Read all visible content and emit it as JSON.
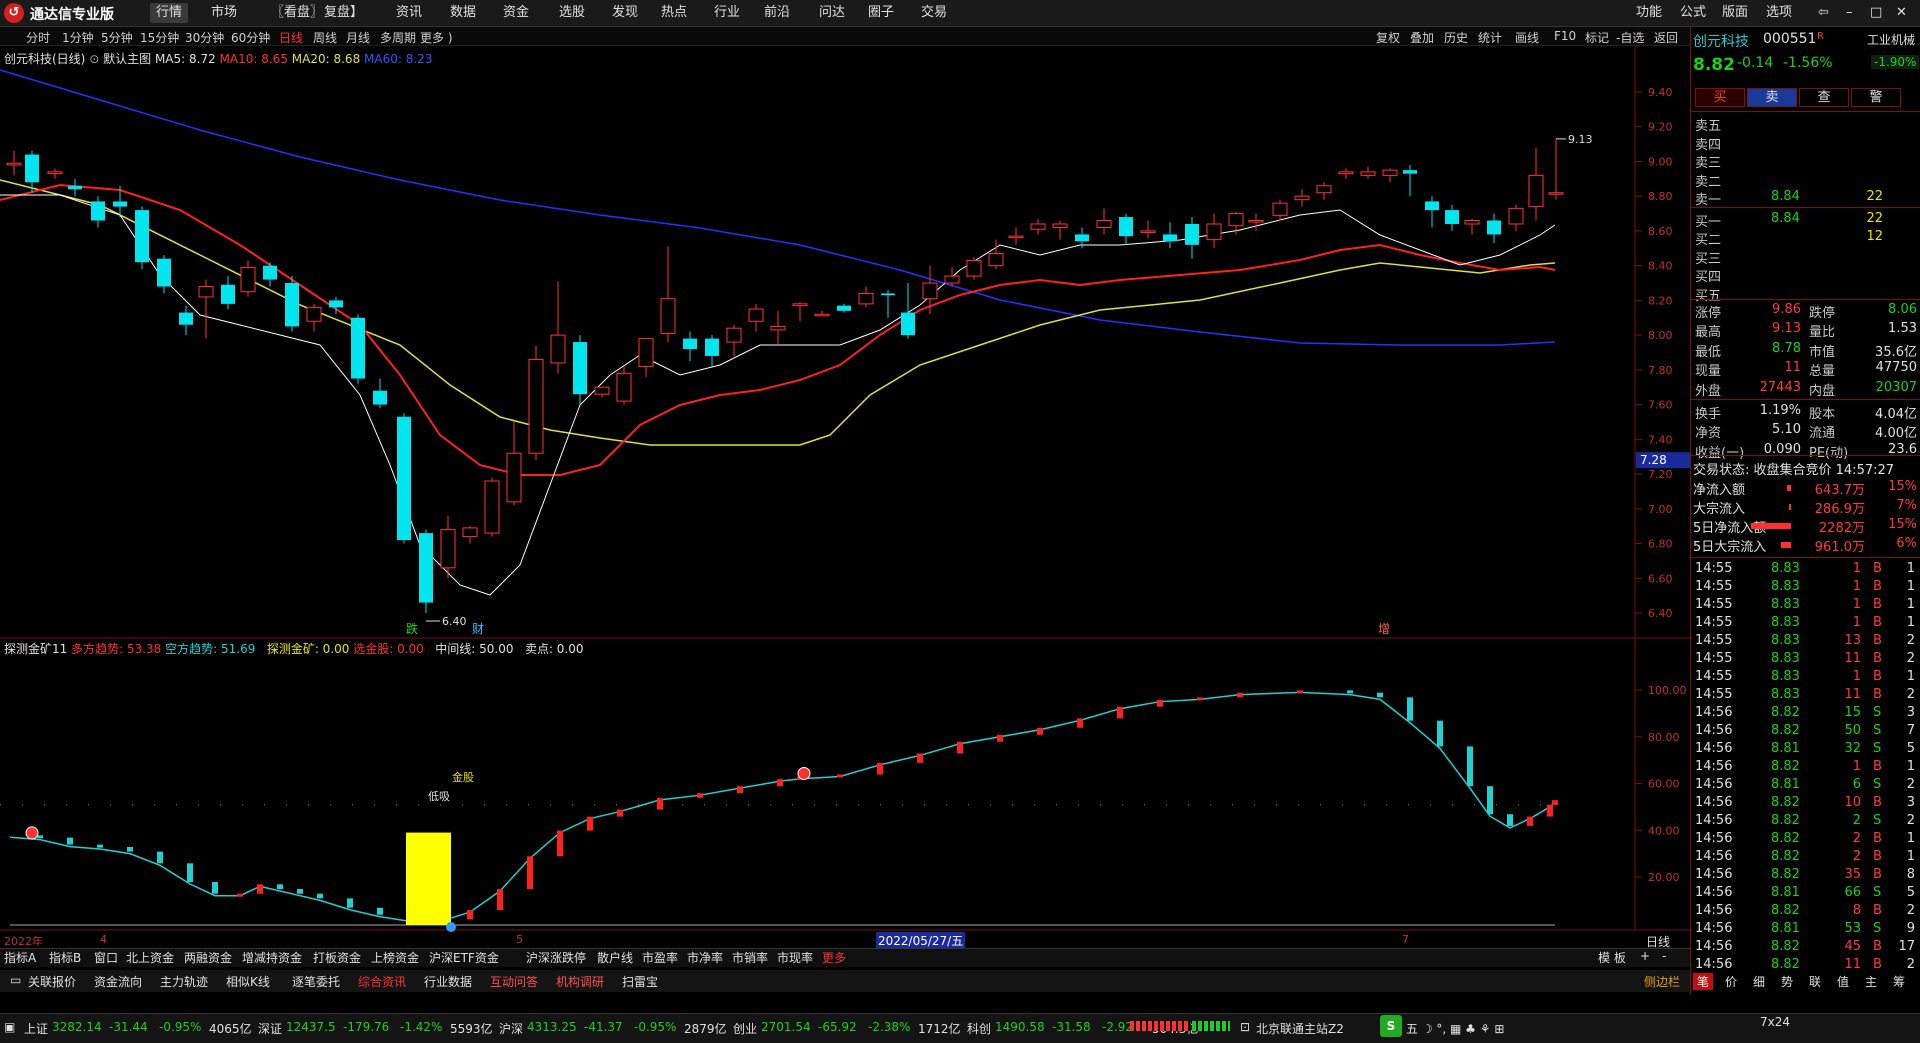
{
  "app": {
    "title": "通达信专业版"
  },
  "menu": [
    "行情",
    "市场",
    "〖看盘〗",
    "复盘】",
    "资讯",
    "数据",
    "资金",
    "选股",
    "发现",
    "热点",
    "行业",
    "前沿",
    "问达",
    "圈子",
    "交易"
  ],
  "menu_right": [
    "功能",
    "公式",
    "版面",
    "选项"
  ],
  "periods": [
    "分时",
    "1分钟",
    "5分钟",
    "15分钟",
    "30分钟",
    "60分钟",
    "日线",
    "周线",
    "月线",
    "多周期",
    "更多 )"
  ],
  "active_period": "日线",
  "tools": [
    "复权",
    "叠加",
    "历史",
    "统计",
    "画线",
    "F10",
    "标记",
    "-自选",
    "返回"
  ],
  "chart": {
    "stock_label": "创元科技(日线)",
    "template": "默认主图",
    "ma5": "MA5: 8.72",
    "ma10": "MA10: 8.65",
    "ma20": "MA20: 8.68",
    "ma60": "MA60: 8.23",
    "price_ticks": [
      "9.40",
      "9.20",
      "9.00",
      "8.80",
      "8.60",
      "8.40",
      "8.20",
      "8.00",
      "7.80",
      "7.60",
      "7.40",
      "7.20",
      "7.00",
      "6.80",
      "6.60",
      "6.40"
    ],
    "current_price_tag": "7.28",
    "high_mark": "9.13",
    "low_mark": "6.40",
    "event_labels": [
      "跌",
      "财",
      "增"
    ],
    "colors": {
      "up": "#ff3333",
      "down": "#00e5ee",
      "ma5": "#ffffff",
      "ma10": "#ff2020",
      "ma20": "#e0e040",
      "ma60": "#2233ff"
    }
  },
  "indicator": {
    "name": "探测金矿11",
    "bull": "多方趋势: 53.38",
    "bear": "空方趋势: 51.69",
    "probe": "探测金矿: 0.00",
    "pick": "选金股: 0.00",
    "mid": "中间线: 50.00",
    "sell": "卖点: 0.00",
    "ticks": [
      "100.00",
      "80.00",
      "60.00",
      "40.00",
      "20.00"
    ],
    "gold_label": "金股",
    "low_buy_label": "低吸"
  },
  "date_axis": {
    "year": "2022年",
    "m1": "4",
    "m2": "5",
    "date_tag": "2022/05/27/五",
    "m3": "7",
    "period": "日线"
  },
  "stock": {
    "name": "创元科技",
    "code": "000551",
    "flag": "R",
    "price": "8.82",
    "change": "-0.14",
    "pct": "-1.56%",
    "industry": "工业机械",
    "industry_pct": "-1.90%",
    "buttons": [
      "买",
      "卖",
      "查",
      "警"
    ]
  },
  "orderbook": {
    "sells": [
      {
        "l": "卖五",
        "p": "",
        "v": ""
      },
      {
        "l": "卖四",
        "p": "",
        "v": ""
      },
      {
        "l": "卖三",
        "p": "",
        "v": ""
      },
      {
        "l": "卖二",
        "p": "",
        "v": ""
      },
      {
        "l": "卖一",
        "p": "8.84",
        "v": "22"
      }
    ],
    "buys": [
      {
        "l": "买一",
        "p": "8.84",
        "v": "22"
      },
      {
        "l": "买二",
        "p": "",
        "v": "12"
      },
      {
        "l": "买三",
        "p": "",
        "v": ""
      },
      {
        "l": "买四",
        "p": "",
        "v": ""
      },
      {
        "l": "买五",
        "p": "",
        "v": ""
      }
    ]
  },
  "stats": [
    [
      "涨停",
      "9.86",
      "跌停",
      "8.06"
    ],
    [
      "最高",
      "9.13",
      "量比",
      "1.53"
    ],
    [
      "最低",
      "8.78",
      "市值",
      "35.6亿"
    ],
    [
      "现量",
      "11",
      "总量",
      "47750"
    ],
    [
      "外盘",
      "27443",
      "内盘",
      "20307"
    ],
    [
      "换手",
      "1.19%",
      "股本",
      "4.04亿"
    ],
    [
      "净资",
      "5.10",
      "流通",
      "4.00亿"
    ],
    [
      "收益(一)",
      "0.090",
      "PE(动)",
      "23.6"
    ]
  ],
  "trade_status": "交易状态: 收盘集合竞价 14:57:27",
  "flows": [
    {
      "l": "净流入额",
      "v": "643.7万",
      "p": "15%"
    },
    {
      "l": "大宗流入",
      "v": "286.9万",
      "p": "7%"
    },
    {
      "l": "5日净流入额",
      "v": "2282万",
      "p": "15%"
    },
    {
      "l": "5日大宗流入",
      "v": "961.0万",
      "p": "6%"
    }
  ],
  "ticks": [
    [
      "14:55",
      "8.83",
      "1",
      "B",
      "1"
    ],
    [
      "14:55",
      "8.83",
      "1",
      "B",
      "1"
    ],
    [
      "14:55",
      "8.83",
      "1",
      "B",
      "1"
    ],
    [
      "14:55",
      "8.83",
      "1",
      "B",
      "1"
    ],
    [
      "14:55",
      "8.83",
      "13",
      "B",
      "2"
    ],
    [
      "14:55",
      "8.83",
      "11",
      "B",
      "2"
    ],
    [
      "14:55",
      "8.83",
      "1",
      "B",
      "1"
    ],
    [
      "14:55",
      "8.83",
      "11",
      "B",
      "2"
    ],
    [
      "14:56",
      "8.82",
      "15",
      "S",
      "3"
    ],
    [
      "14:56",
      "8.82",
      "50",
      "S",
      "7"
    ],
    [
      "14:56",
      "8.81",
      "32",
      "S",
      "5"
    ],
    [
      "14:56",
      "8.82",
      "1",
      "B",
      "1"
    ],
    [
      "14:56",
      "8.81",
      "6",
      "S",
      "2"
    ],
    [
      "14:56",
      "8.82",
      "10",
      "B",
      "3"
    ],
    [
      "14:56",
      "8.82",
      "2",
      "S",
      "2"
    ],
    [
      "14:56",
      "8.82",
      "2",
      "B",
      "1"
    ],
    [
      "14:56",
      "8.82",
      "2",
      "B",
      "1"
    ],
    [
      "14:56",
      "8.82",
      "35",
      "B",
      "8"
    ],
    [
      "14:56",
      "8.81",
      "66",
      "S",
      "5"
    ],
    [
      "14:56",
      "8.82",
      "8",
      "B",
      "2"
    ],
    [
      "14:56",
      "8.81",
      "53",
      "S",
      "9"
    ],
    [
      "14:56",
      "8.82",
      "45",
      "B",
      "17"
    ],
    [
      "14:56",
      "8.82",
      "11",
      "B",
      "2"
    ]
  ],
  "bottom_tabs1": [
    "指标A",
    "指标B",
    "窗口",
    "北上资金",
    "两融资金",
    "增减持资金",
    "打板资金",
    "上榜资金",
    "沪深ETF资金",
    "沪深涨跌停",
    "散户线",
    "市盈率",
    "市净率",
    "市销率",
    "市现率",
    "更多"
  ],
  "bottom_tabs1_right": [
    "模 板",
    "+",
    "-"
  ],
  "bottom_tabs2": [
    "关联报价",
    "资金流向",
    "主力轨迹",
    "相似K线",
    "逐笔委托",
    "综合资讯",
    "行业数据",
    "互动问答",
    "机构调研",
    "扫雷宝"
  ],
  "bottom_tabs2_right": "侧边栏",
  "right_tabs": [
    "笔",
    "价",
    "细",
    "势",
    "联",
    "值",
    "主",
    "筹"
  ],
  "indices": [
    {
      "n": "上证",
      "v": "3282.14",
      "c": "-31.44",
      "p": "-0.95%",
      "a": "4065亿"
    },
    {
      "n": "深证",
      "v": "12437.5",
      "c": "-179.76",
      "p": "-1.42%",
      "a": "5593亿"
    },
    {
      "n": "沪深",
      "v": "4313.25",
      "c": "-41.37",
      "p": "-0.95%",
      "a": "2879亿"
    },
    {
      "n": "创业",
      "v": "2701.54",
      "c": "-65.92",
      "p": "-2.38%",
      "a": "1712亿"
    },
    {
      "n": "科创",
      "v": "1490.58",
      "c": "-31.58",
      "p": "-2.92%",
      "a": "504.3亿"
    }
  ],
  "server": "北京联通主站Z2",
  "clock": "7x24"
}
